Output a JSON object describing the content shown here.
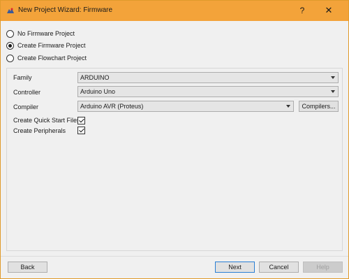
{
  "window": {
    "title": "New Project Wizard: Firmware",
    "help_glyph": "?",
    "close_glyph": "✕",
    "accent_color": "#f3a33a"
  },
  "project_type": {
    "options": [
      {
        "label": "No Firmware Project",
        "selected": false
      },
      {
        "label": "Create Firmware Project",
        "selected": true
      },
      {
        "label": "Create Flowchart Project",
        "selected": false
      }
    ]
  },
  "settings": {
    "family": {
      "label": "Family",
      "value": "ARDUINO"
    },
    "controller": {
      "label": "Controller",
      "value": "Arduino Uno"
    },
    "compiler": {
      "label": "Compiler",
      "value": "Arduino AVR (Proteus)"
    },
    "compilers_button": "Compilers...",
    "quick_start": {
      "label": "Create Quick Start Files",
      "checked": true
    },
    "peripherals": {
      "label": "Create Peripherals",
      "checked": true
    }
  },
  "footer": {
    "back": "Back",
    "next": "Next",
    "cancel": "Cancel",
    "help": "Help"
  }
}
